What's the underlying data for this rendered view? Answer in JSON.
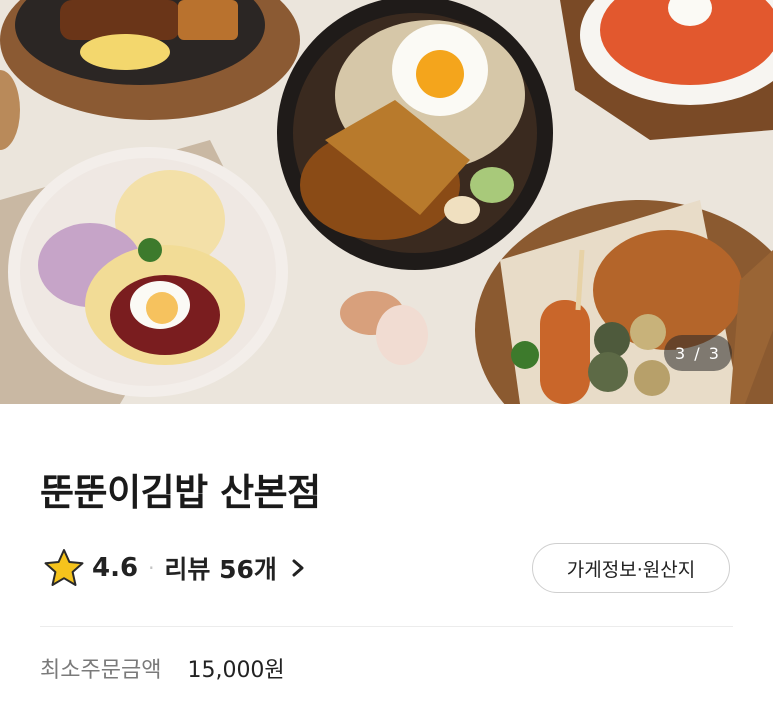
{
  "hero": {
    "image_description": "food-photo",
    "counter": "3 / 3"
  },
  "store": {
    "name": "뚠뚠이김밥 산본점"
  },
  "rating": {
    "score": "4.6",
    "separator": "·",
    "review_label": "리뷰 56개"
  },
  "info_button": {
    "label": "가게정보·원산지"
  },
  "min_order": {
    "label": "최소주문금액",
    "value": "15,000원"
  },
  "colors": {
    "star": "#f5c31c",
    "text": "#222222",
    "muted": "#7a7a7a"
  }
}
